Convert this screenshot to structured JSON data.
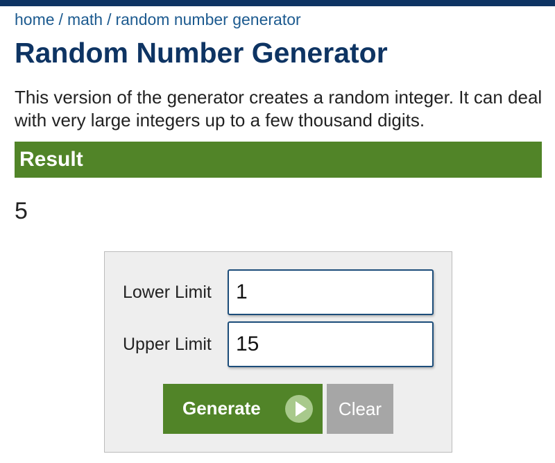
{
  "breadcrumb": {
    "items": [
      "home",
      "math",
      "random number generator"
    ],
    "separator": "/"
  },
  "page": {
    "title": "Random Number Generator",
    "description": "This version of the generator creates a random integer. It can deal with very large integers up to a few thousand digits."
  },
  "result": {
    "header": "Result",
    "value": "5"
  },
  "form": {
    "lower_label": "Lower Limit",
    "lower_value": "1",
    "upper_label": "Upper Limit",
    "upper_value": "15",
    "generate_label": "Generate",
    "clear_label": "Clear"
  },
  "colors": {
    "brand_navy": "#0e3463",
    "link_blue": "#1c5a8f",
    "accent_green": "#518428",
    "clear_gray": "#a6a6a6"
  },
  "icons": {
    "generate_button_icon": "play-circle-icon"
  }
}
